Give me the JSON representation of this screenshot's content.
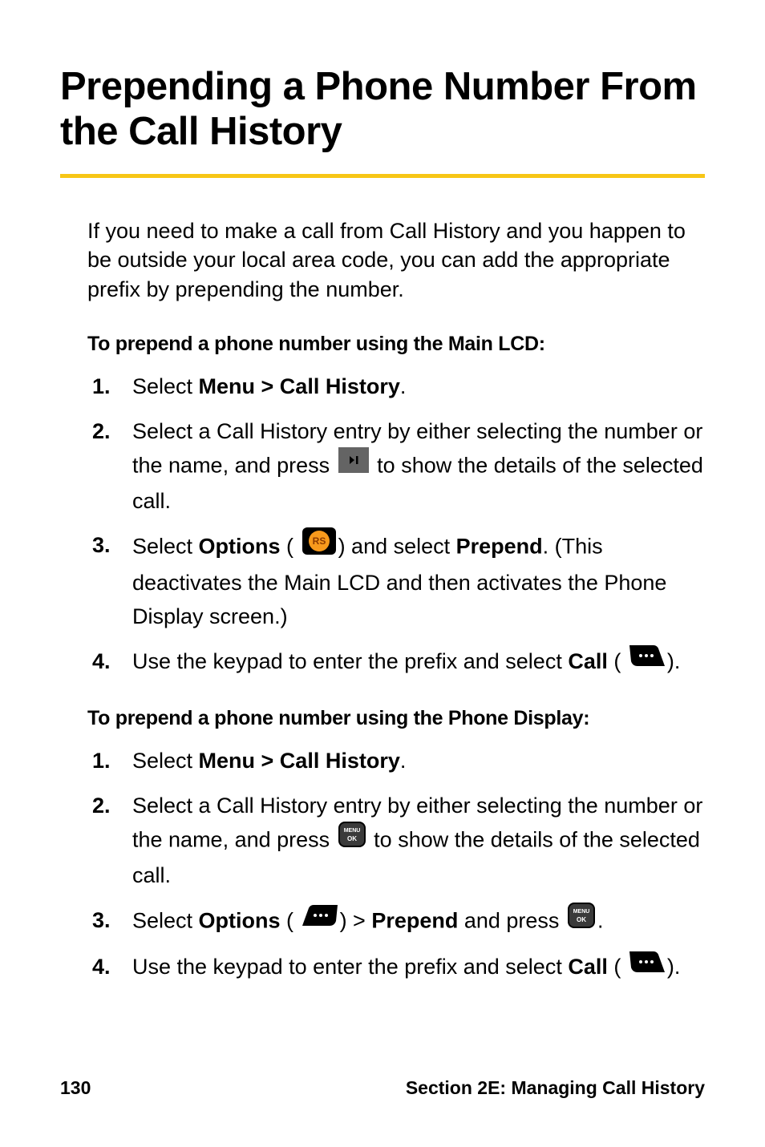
{
  "title": "Prepending a Phone Number From the Call History",
  "intro": "If you need to make a call from Call History and you happen to be outside your local area code, you can add the appropriate prefix by prepending the number.",
  "section1_heading": "To prepend a phone number using the Main LCD:",
  "section1_steps": {
    "s1_num": "1.",
    "s1_a": "Select ",
    "s1_b": "Menu > Call History",
    "s1_c": ".",
    "s2_num": "2.",
    "s2_a": "Select a Call History entry by either selecting the number or the name, and press ",
    "s2_b": " to show the details of the selected call.",
    "s3_num": "3.",
    "s3_a": "Select ",
    "s3_b": "Options",
    "s3_c": " (",
    "s3_d": ") and select ",
    "s3_e": "Prepend",
    "s3_f": ". (This deactivates the Main LCD and then activates the Phone Display screen.)",
    "s4_num": "4.",
    "s4_a": "Use the keypad to enter the prefix and select ",
    "s4_b": "Call",
    "s4_c": " (",
    "s4_d": ")."
  },
  "section2_heading": "To prepend a phone number using the Phone Display:",
  "section2_steps": {
    "s1_num": "1.",
    "s1_a": "Select ",
    "s1_b": "Menu > Call History",
    "s1_c": ".",
    "s2_num": "2.",
    "s2_a": "Select a Call History entry by either selecting the number or the name, and press ",
    "s2_b": " to show the details of the selected call.",
    "s3_num": "3.",
    "s3_a": "Select ",
    "s3_b": "Options",
    "s3_c": " (",
    "s3_d": ") > ",
    "s3_e": "Prepend",
    "s3_f": " and press ",
    "s3_g": ".",
    "s4_num": "4.",
    "s4_a": "Use the keypad to enter the prefix and select ",
    "s4_b": "Call",
    "s4_c": " (",
    "s4_d": ")."
  },
  "footer_page": "130",
  "footer_section": "Section 2E: Managing Call History"
}
